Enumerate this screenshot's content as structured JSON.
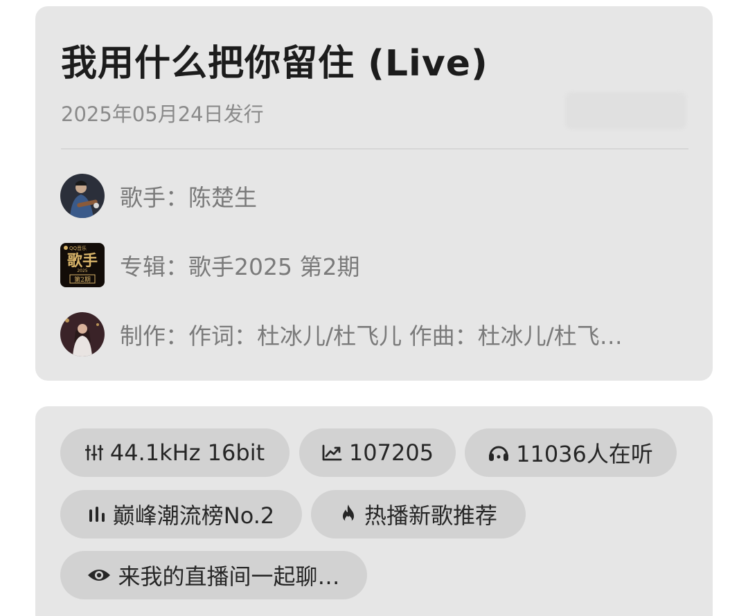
{
  "song": {
    "title": "我用什么把你留住 (Live)",
    "release_date": "2025年05月24日发行"
  },
  "info_rows": {
    "artist": {
      "label": "歌手：",
      "value": "陈楚生",
      "thumb": "artist-avatar"
    },
    "album": {
      "label": "专辑：",
      "value": "歌手2025 第2期",
      "thumb": "album-cover"
    },
    "credits": {
      "label": "制作：",
      "value": "作词：杜冰儿/杜飞儿  作曲：杜冰儿/杜飞…",
      "thumb": "producer-avatar"
    }
  },
  "tags": {
    "quality": {
      "label": "44.1kHz  16bit",
      "icon": "sliders-icon"
    },
    "plays": {
      "label": "107205",
      "icon": "trending-up-icon"
    },
    "listeners": {
      "label": "11036人在听",
      "icon": "headphones-icon"
    },
    "chart": {
      "label": "巅峰潮流榜No.2",
      "icon": "bar-chart-icon"
    },
    "hot": {
      "label": "热播新歌推荐",
      "icon": "flame-icon"
    },
    "live": {
      "label": "来我的直播间一起聊…",
      "icon": "eye-icon"
    }
  },
  "album_cover_text": {
    "brand": "QQ音乐",
    "name": "歌手",
    "year": "2025",
    "episode": "第2期"
  },
  "colors": {
    "card_bg": "#e6e6e6",
    "chip_bg": "#d2d2d2",
    "title": "#1c1c1c",
    "secondary_text": "#7a7a7a"
  }
}
